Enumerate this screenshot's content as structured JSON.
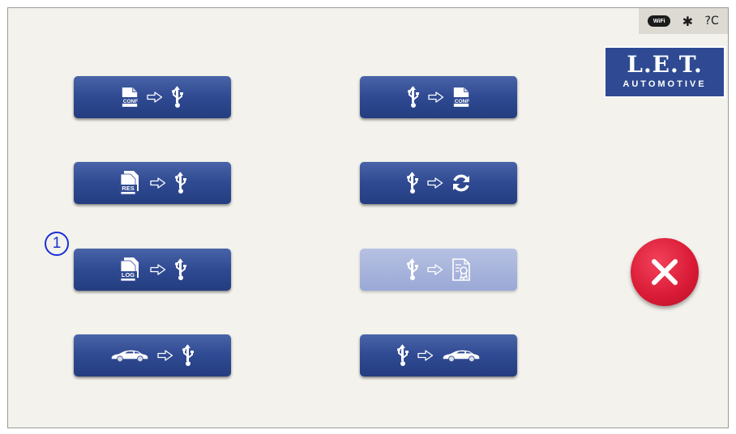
{
  "status_bar": {
    "wifi_label": "WiFi",
    "bluetooth_glyph": "✱",
    "unknown_label": "?C"
  },
  "logo": {
    "line1": "L.E.T.",
    "line2": "AUTOMOTIVE"
  },
  "callout": {
    "number": "1"
  },
  "buttons": {
    "conf_export": {
      "file_label": "CONF",
      "icons": [
        "conf-file-icon",
        "arrow-right-icon",
        "usb-icon"
      ]
    },
    "res_export": {
      "file_label": "RES",
      "icons": [
        "res-file-icon",
        "arrow-right-icon",
        "usb-icon"
      ]
    },
    "log_export": {
      "file_label": "LOG",
      "icons": [
        "log-file-icon",
        "arrow-right-icon",
        "usb-icon"
      ]
    },
    "car_export": {
      "icons": [
        "car-icon",
        "arrow-right-icon",
        "usb-icon"
      ]
    },
    "conf_import": {
      "file_label": "CONF",
      "icons": [
        "usb-icon",
        "arrow-right-icon",
        "conf-file-icon"
      ]
    },
    "update": {
      "icons": [
        "usb-icon",
        "arrow-right-icon",
        "refresh-icon"
      ]
    },
    "certificate_import": {
      "icons": [
        "usb-icon",
        "arrow-right-icon",
        "certificate-icon"
      ],
      "state": "disabled"
    },
    "car_import": {
      "icons": [
        "usb-icon",
        "arrow-right-icon",
        "car-icon"
      ]
    }
  },
  "colors": {
    "button": "#2f4a92",
    "button_disabled": "#9aa8d6",
    "close": "#d81a35",
    "callout": "#1a2fd8",
    "background": "#f3f2ec"
  }
}
